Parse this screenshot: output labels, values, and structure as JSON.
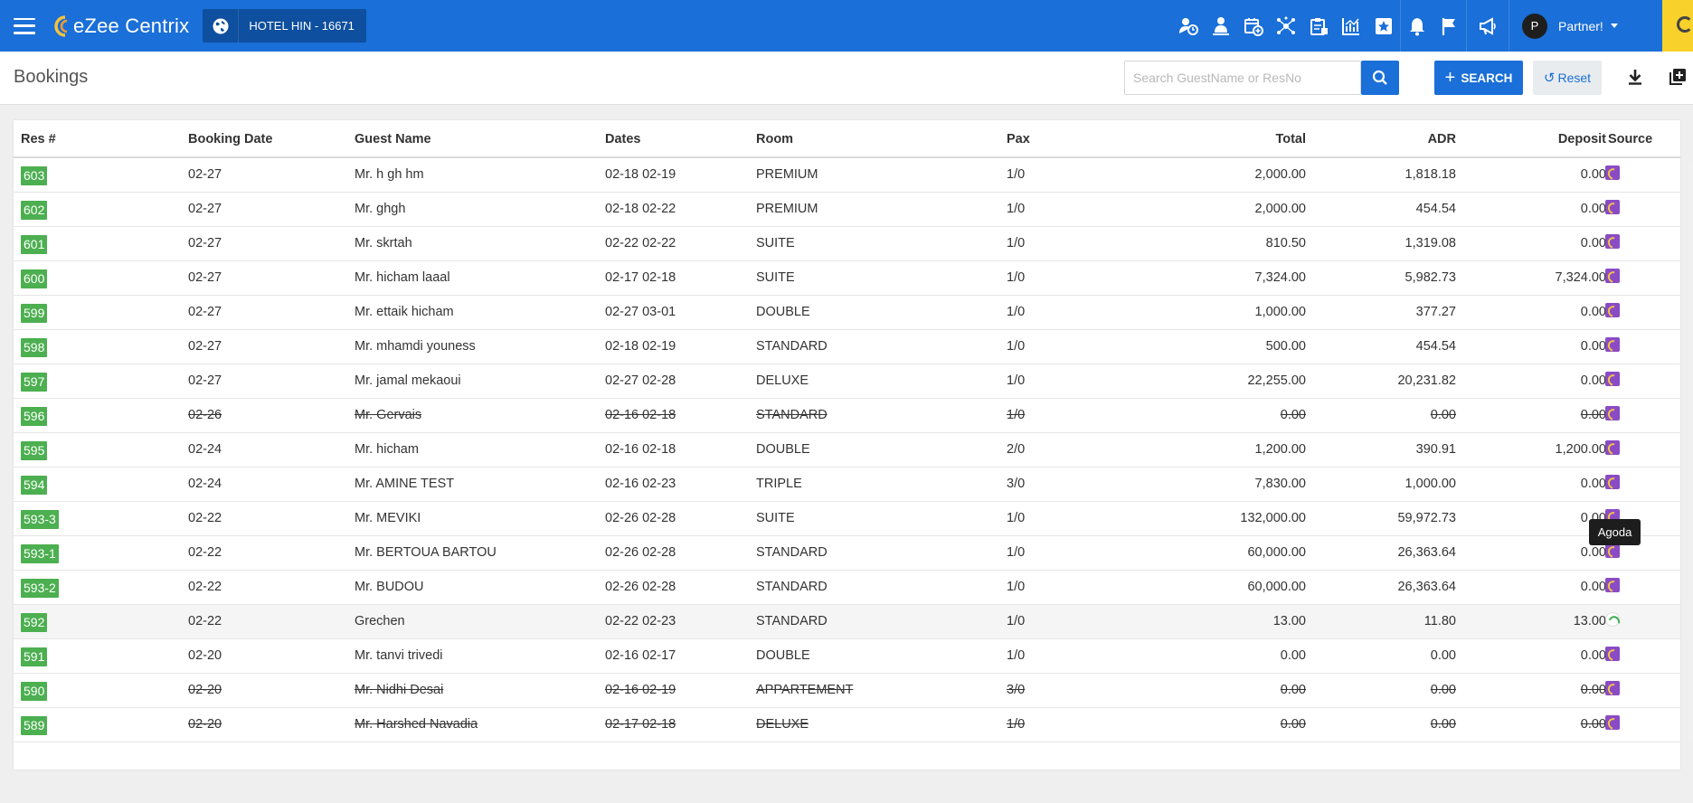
{
  "topbar": {
    "brand": "eZee Centrix",
    "hotel": "HOTEL HIN -  16671",
    "user_initial": "P",
    "user_name": "Partner!",
    "icons": [
      "arrivals-icon",
      "departures-icon",
      "calendar-add-icon",
      "network-icon",
      "clipboard-icon",
      "chart-icon",
      "star-plus-icon",
      "bell-icon",
      "flag-icon",
      "megaphone-icon"
    ]
  },
  "header": {
    "title": "Bookings",
    "search_placeholder": "Search GuestName or ResNo",
    "search_label": "SEARCH",
    "reset_label": "Reset"
  },
  "table": {
    "columns": [
      "Res #",
      "Booking Date",
      "Guest Name",
      "Dates",
      "Room",
      "Pax",
      "Total",
      "ADR",
      "Deposit",
      "Source"
    ],
    "rows": [
      {
        "res": "603",
        "booking_date": "02-27",
        "guest": "Mr. h gh hm",
        "dates": "02-18 02-19",
        "room": "PREMIUM",
        "pax": "1/0",
        "total": "2,000.00",
        "adr": "1,818.18",
        "deposit": "0.00",
        "source": "ezee",
        "cancelled": false
      },
      {
        "res": "602",
        "booking_date": "02-27",
        "guest": "Mr. ghgh",
        "dates": "02-18 02-22",
        "room": "PREMIUM",
        "pax": "1/0",
        "total": "2,000.00",
        "adr": "454.54",
        "deposit": "0.00",
        "source": "ezee",
        "cancelled": false
      },
      {
        "res": "601",
        "booking_date": "02-27",
        "guest": "Mr. skrtah",
        "dates": "02-22 02-22",
        "room": "SUITE",
        "pax": "1/0",
        "total": "810.50",
        "adr": "1,319.08",
        "deposit": "0.00",
        "source": "ezee",
        "cancelled": false
      },
      {
        "res": "600",
        "booking_date": "02-27",
        "guest": "Mr. hicham laaal",
        "dates": "02-17 02-18",
        "room": "SUITE",
        "pax": "1/0",
        "total": "7,324.00",
        "adr": "5,982.73",
        "deposit": "7,324.00",
        "source": "ezee",
        "cancelled": false
      },
      {
        "res": "599",
        "booking_date": "02-27",
        "guest": "Mr. ettaik hicham",
        "dates": "02-27 03-01",
        "room": "DOUBLE",
        "pax": "1/0",
        "total": "1,000.00",
        "adr": "377.27",
        "deposit": "0.00",
        "source": "ezee",
        "cancelled": false
      },
      {
        "res": "598",
        "booking_date": "02-27",
        "guest": "Mr. mhamdi youness",
        "dates": "02-18 02-19",
        "room": "STANDARD",
        "pax": "1/0",
        "total": "500.00",
        "adr": "454.54",
        "deposit": "0.00",
        "source": "ezee",
        "cancelled": false
      },
      {
        "res": "597",
        "booking_date": "02-27",
        "guest": "Mr. jamal mekaoui",
        "dates": "02-27 02-28",
        "room": "DELUXE",
        "pax": "1/0",
        "total": "22,255.00",
        "adr": "20,231.82",
        "deposit": "0.00",
        "source": "ezee",
        "cancelled": false
      },
      {
        "res": "596",
        "booking_date": "02-26",
        "guest": "Mr. Gervais",
        "dates": "02-16 02-18",
        "room": "STANDARD",
        "pax": "1/0",
        "total": "0.00",
        "adr": "0.00",
        "deposit": "0.00",
        "source": "ezee",
        "cancelled": true
      },
      {
        "res": "595",
        "booking_date": "02-24",
        "guest": "Mr. hicham",
        "dates": "02-16 02-18",
        "room": "DOUBLE",
        "pax": "2/0",
        "total": "1,200.00",
        "adr": "390.91",
        "deposit": "1,200.00",
        "source": "ezee",
        "cancelled": false
      },
      {
        "res": "594",
        "booking_date": "02-24",
        "guest": "Mr. AMINE TEST",
        "dates": "02-16 02-23",
        "room": "TRIPLE",
        "pax": "3/0",
        "total": "7,830.00",
        "adr": "1,000.00",
        "deposit": "0.00",
        "source": "ezee",
        "cancelled": false
      },
      {
        "res": "593-3",
        "booking_date": "02-22",
        "guest": "Mr. MEVIKI",
        "dates": "02-26 02-28",
        "room": "SUITE",
        "pax": "1/0",
        "total": "132,000.00",
        "adr": "59,972.73",
        "deposit": "0.00",
        "source": "ezee",
        "cancelled": false
      },
      {
        "res": "593-1",
        "booking_date": "02-22",
        "guest": "Mr. BERTOUA BARTOU",
        "dates": "02-26 02-28",
        "room": "STANDARD",
        "pax": "1/0",
        "total": "60,000.00",
        "adr": "26,363.64",
        "deposit": "0.00",
        "source": "ezee",
        "cancelled": false
      },
      {
        "res": "593-2",
        "booking_date": "02-22",
        "guest": "Mr. BUDOU",
        "dates": "02-26 02-28",
        "room": "STANDARD",
        "pax": "1/0",
        "total": "60,000.00",
        "adr": "26,363.64",
        "deposit": "0.00",
        "source": "ezee",
        "cancelled": false
      },
      {
        "res": "592",
        "booking_date": "02-22",
        "guest": "Grechen",
        "dates": "02-22 02-23",
        "room": "STANDARD",
        "pax": "1/0",
        "total": "13.00",
        "adr": "11.80",
        "deposit": "13.00",
        "source": "agoda",
        "cancelled": false
      },
      {
        "res": "591",
        "booking_date": "02-20",
        "guest": "Mr. tanvi trivedi",
        "dates": "02-16 02-17",
        "room": "DOUBLE",
        "pax": "1/0",
        "total": "0.00",
        "adr": "0.00",
        "deposit": "0.00",
        "source": "ezee",
        "cancelled": false
      },
      {
        "res": "590",
        "booking_date": "02-20",
        "guest": "Mr. Nidhi Desai",
        "dates": "02-16 02-19",
        "room": "APPARTEMENT",
        "pax": "3/0",
        "total": "0.00",
        "adr": "0.00",
        "deposit": "0.00",
        "source": "ezee",
        "cancelled": true
      },
      {
        "res": "589",
        "booking_date": "02-20",
        "guest": "Mr. Harshed Navadia",
        "dates": "02-17 02-18",
        "room": "DELUXE",
        "pax": "1/0",
        "total": "0.00",
        "adr": "0.00",
        "deposit": "0.00",
        "source": "ezee",
        "cancelled": true
      }
    ]
  },
  "tooltip": "Agoda",
  "colors": {
    "primary": "#1a6fd8",
    "badge": "#4caf50",
    "source_icon": "#8a4bc5"
  }
}
